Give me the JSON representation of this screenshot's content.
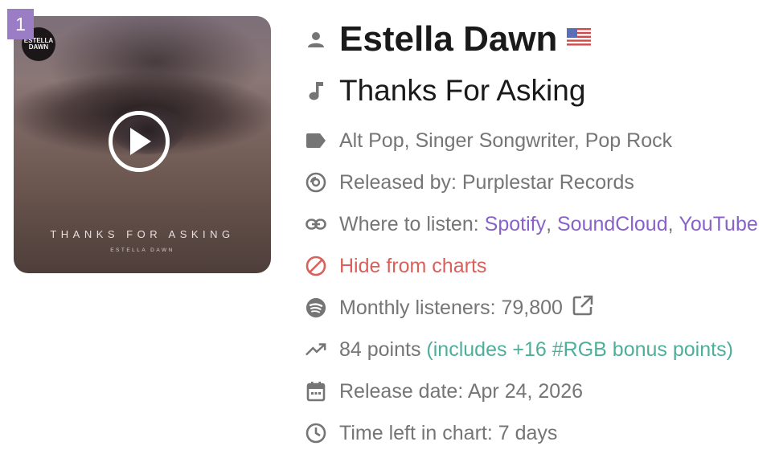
{
  "rank": "1",
  "cover": {
    "art_title": "THANKS FOR ASKING",
    "art_artist": "ESTELLA DAWN",
    "logo_text": "ESTELLA DAWN"
  },
  "artist": {
    "name": "Estella Dawn",
    "flag_icon": "us-flag-icon"
  },
  "song": {
    "title": "Thanks For Asking"
  },
  "genres": "Alt Pop, Singer Songwriter, Pop Rock",
  "label": "Released by: Purplestar Records",
  "listen": {
    "prefix": "Where to listen: ",
    "links": [
      "Spotify",
      "SoundCloud",
      "YouTube"
    ],
    "separator": ", "
  },
  "hide_label": "Hide from charts",
  "monthly_listeners": "Monthly listeners: 79,800",
  "points": {
    "value": "84 points",
    "bonus": "(includes +16 #RGB bonus points)"
  },
  "release_date": "Release date: Apr 24, 2026",
  "time_left": "Time left in chart: 7 days",
  "colors": {
    "accent": "#8862c9",
    "rank_badge": "#9b7dc6",
    "warning": "#d9605b",
    "bonus": "#4fae9a"
  }
}
